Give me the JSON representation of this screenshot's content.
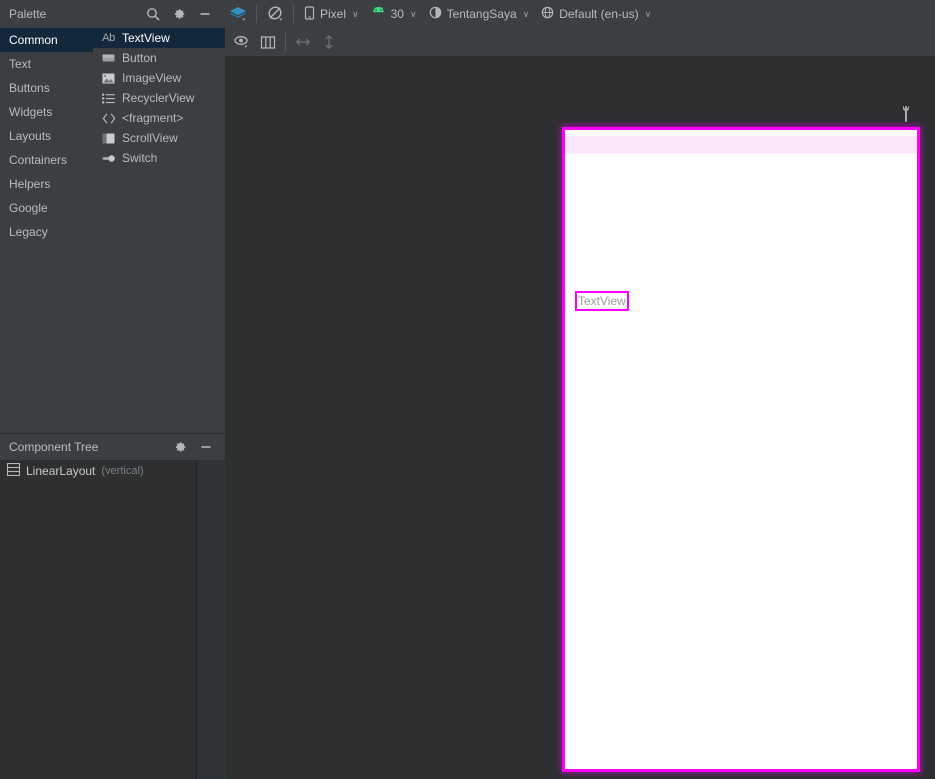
{
  "palette": {
    "title": "Palette",
    "header_icons": [
      {
        "name": "search-icon"
      },
      {
        "name": "gear-icon"
      },
      {
        "name": "minimize-icon"
      }
    ],
    "categories": [
      {
        "label": "Common",
        "selected": true
      },
      {
        "label": "Text",
        "selected": false
      },
      {
        "label": "Buttons",
        "selected": false
      },
      {
        "label": "Widgets",
        "selected": false
      },
      {
        "label": "Layouts",
        "selected": false
      },
      {
        "label": "Containers",
        "selected": false
      },
      {
        "label": "Helpers",
        "selected": false
      },
      {
        "label": "Google",
        "selected": false
      },
      {
        "label": "Legacy",
        "selected": false
      }
    ],
    "items": [
      {
        "label": "TextView",
        "icon": "textview-icon",
        "selected": true
      },
      {
        "label": "Button",
        "icon": "button-icon",
        "selected": false
      },
      {
        "label": "ImageView",
        "icon": "imageview-icon",
        "selected": false
      },
      {
        "label": "RecyclerView",
        "icon": "recyclerview-icon",
        "selected": false
      },
      {
        "label": "<fragment>",
        "icon": "fragment-icon",
        "selected": false
      },
      {
        "label": "ScrollView",
        "icon": "scrollview-icon",
        "selected": false
      },
      {
        "label": "Switch",
        "icon": "switch-icon",
        "selected": false
      }
    ]
  },
  "component_tree": {
    "title": "Component Tree",
    "header_icons": [
      {
        "name": "gear-icon"
      },
      {
        "name": "minimize-icon"
      }
    ],
    "nodes": [
      {
        "label": "LinearLayout",
        "detail": "(vertical)",
        "icon": "linearlayout-icon"
      }
    ]
  },
  "editor_toolbar": {
    "mode_icon": "design-layers-icon",
    "orientation_icon": "rotate-device-icon",
    "device": {
      "icon": "phone-icon",
      "label": "Pixel",
      "caret": "∨"
    },
    "api": {
      "icon": "android-icon",
      "label": "30",
      "caret": "∨"
    },
    "theme": {
      "icon": "theme-contrast-icon",
      "label": "TentangSaya",
      "caret": "∨"
    },
    "locale": {
      "icon": "globe-icon",
      "label": "Default (en-us)",
      "caret": "∨"
    }
  },
  "surface_toolbar": {
    "buttons": [
      {
        "name": "view-options-icon"
      },
      {
        "name": "blueprint-columns-icon"
      },
      {
        "name": "fit-width-icon"
      },
      {
        "name": "fit-height-icon"
      }
    ]
  },
  "design_surface": {
    "wrench_icon": "wrench-icon",
    "selection_color": "#ff00ff",
    "device_background": "#ffffff",
    "statusbar_color": "#fce8fb",
    "canvas_background": "#2d2f31",
    "widgets": [
      {
        "type": "TextView",
        "text": "TextView",
        "selected": true
      }
    ]
  }
}
